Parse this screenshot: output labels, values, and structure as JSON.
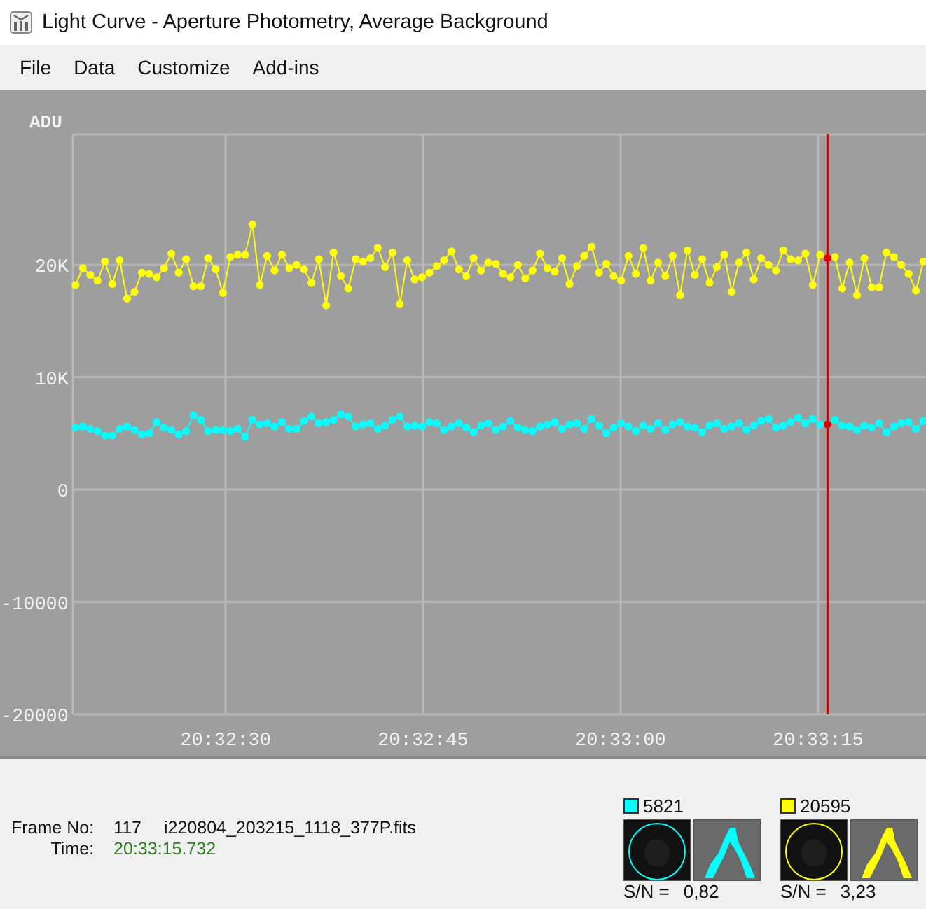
{
  "window": {
    "title": "Light Curve - Aperture Photometry, Average Background"
  },
  "menu": [
    {
      "label": "File"
    },
    {
      "label": "Data"
    },
    {
      "label": "Customize"
    },
    {
      "label": "Add-ins"
    }
  ],
  "plot": {
    "chart_data": {
      "type": "line",
      "ylabel": "ADU",
      "x": [
        73938.6,
        73939.16,
        73939.72,
        73940.28,
        73940.84,
        73941.4,
        73941.96,
        73942.52,
        73943.08,
        73943.64,
        73944.2,
        73944.76,
        73945.32,
        73945.88,
        73946.44,
        73947.0,
        73947.56,
        73948.12,
        73948.68,
        73949.24,
        73949.8,
        73950.36,
        73950.92,
        73951.48,
        73952.04,
        73952.6,
        73953.16,
        73953.72,
        73954.28,
        73954.84,
        73955.4,
        73955.96,
        73956.52,
        73957.08,
        73957.64,
        73958.2,
        73958.76,
        73959.32,
        73959.88,
        73960.44,
        73961.0,
        73961.56,
        73962.12,
        73962.68,
        73963.24,
        73963.8,
        73964.36,
        73964.92,
        73965.48,
        73966.04,
        73966.6,
        73967.16,
        73967.72,
        73968.28,
        73968.84,
        73969.4,
        73969.96,
        73970.52,
        73971.08,
        73971.64,
        73972.2,
        73972.76,
        73973.32,
        73973.88,
        73974.44,
        73975.0,
        73975.56,
        73976.12,
        73976.68,
        73977.24,
        73977.8,
        73978.36,
        73978.92,
        73979.48,
        73980.04,
        73980.6,
        73981.16,
        73981.72,
        73982.28,
        73982.84,
        73983.4,
        73983.96,
        73984.52,
        73985.08,
        73985.64,
        73986.2,
        73986.76,
        73987.32,
        73987.88,
        73988.44,
        73989.0,
        73989.56,
        73990.12,
        73990.68,
        73991.24,
        73991.8,
        73992.36,
        73992.92,
        73993.48,
        73994.04,
        73994.6,
        73995.16,
        73995.72,
        73996.28,
        73996.84,
        73997.4,
        73997.96,
        73998.52,
        73999.08,
        73999.64,
        74000.2,
        74000.76,
        74001.32,
        74001.88,
        74002.44,
        74003.0
      ],
      "series": [
        {
          "color": "#ffff00",
          "marker": "circle",
          "values": [
            18200,
            19700,
            19100,
            18600,
            20300,
            18300,
            20400,
            17000,
            17600,
            19300,
            19200,
            18900,
            19700,
            21000,
            19300,
            20500,
            18100,
            18100,
            20600,
            19600,
            17500,
            20700,
            20900,
            20900,
            23600,
            18200,
            20800,
            19500,
            20900,
            19700,
            20000,
            19600,
            18400,
            20500,
            16400,
            21100,
            19000,
            17900,
            20500,
            20300,
            20600,
            21500,
            19800,
            21100,
            16500,
            20400,
            18700,
            18900,
            19300,
            19900,
            20400,
            21200,
            19600,
            19000,
            20600,
            19500,
            20200,
            20100,
            19200,
            18900,
            20000,
            18800,
            19500,
            21000,
            19700,
            19400,
            20600,
            18300,
            19900,
            20800,
            21600,
            19300,
            20100,
            19000,
            18600,
            20800,
            19200,
            21500,
            18600,
            20200,
            19000,
            20800,
            17300,
            21300,
            19100,
            20500,
            18400,
            19800,
            20900,
            17600,
            20200,
            21100,
            18700,
            20600,
            20000,
            19500,
            21300,
            20500,
            20400,
            21000,
            18200,
            20900,
            20600,
            20700,
            17900,
            20200,
            17300,
            20600,
            18000,
            18000,
            21100,
            20700,
            20000,
            19200,
            17700,
            20300
          ]
        },
        {
          "color": "#00ffff",
          "marker": "circle",
          "values": [
            5500,
            5600,
            5400,
            5200,
            4800,
            4800,
            5400,
            5600,
            5300,
            4900,
            5000,
            6000,
            5500,
            5300,
            4900,
            5200,
            6600,
            6200,
            5200,
            5300,
            5300,
            5200,
            5400,
            4700,
            6200,
            5800,
            5900,
            5600,
            6000,
            5400,
            5400,
            6100,
            6500,
            5900,
            6000,
            6200,
            6700,
            6500,
            5600,
            5800,
            5900,
            5400,
            5700,
            6200,
            6500,
            5600,
            5700,
            5600,
            6000,
            5900,
            5300,
            5600,
            5900,
            5500,
            5100,
            5700,
            5900,
            5300,
            5600,
            6100,
            5500,
            5300,
            5200,
            5600,
            5800,
            6000,
            5400,
            5800,
            5900,
            5400,
            6300,
            5700,
            5000,
            5500,
            5900,
            5600,
            5200,
            5700,
            5400,
            5900,
            5300,
            5800,
            6000,
            5600,
            5500,
            5100,
            5700,
            5900,
            5400,
            5600,
            5900,
            5300,
            5700,
            6100,
            6300,
            5500,
            5700,
            6000,
            6400,
            5900,
            6300,
            5800,
            5800,
            6200,
            5700,
            5600,
            5300,
            5700,
            5500,
            5900,
            5100,
            5600,
            5900,
            6000,
            5400,
            6100
          ]
        }
      ],
      "xlim": [
        73938.4,
        74003.2
      ],
      "ylim": [
        -20000,
        31600
      ],
      "xticks": [
        {
          "value": 73950,
          "label": "20:32:30"
        },
        {
          "value": 73965,
          "label": "20:32:45"
        },
        {
          "value": 73980,
          "label": "20:33:00"
        },
        {
          "value": 73995,
          "label": "20:33:15"
        }
      ],
      "yticks": [
        {
          "value": 20000,
          "label": "20K"
        },
        {
          "value": 10000,
          "label": "10K"
        },
        {
          "value": 0,
          "label": "0"
        },
        {
          "value": -10000,
          "label": "-10000"
        },
        {
          "value": -20000,
          "label": "-20000"
        }
      ],
      "grid": true,
      "ref_lines": [
        {
          "axis": "x",
          "value": 73995.72,
          "color": "#c00000"
        }
      ]
    }
  },
  "info": {
    "frame_label": "Frame No:",
    "frame_number": "117",
    "file_name": "i220804_203215_1118_377P.fits",
    "time_label": "Time:",
    "time": "20:33:15.732"
  },
  "targets": [
    {
      "color": "#00ffff",
      "value": "5821",
      "sn_label": "S/N =",
      "sn": "0,82"
    },
    {
      "color": "#ffff00",
      "value": "20595",
      "sn_label": "S/N =",
      "sn": "3,23"
    }
  ]
}
